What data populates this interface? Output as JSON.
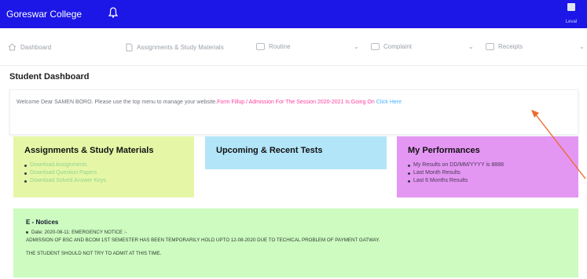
{
  "header": {
    "brand": "Goreswar College",
    "user_label": "Leval"
  },
  "menu": {
    "items": [
      {
        "label": "Dashboard",
        "icon": "home-icon"
      },
      {
        "label": "Assignments & Study Materials",
        "icon": "document-icon"
      },
      {
        "label": "Routine",
        "icon": "calendar-icon"
      },
      {
        "label": "Complaint",
        "icon": "comment-icon"
      },
      {
        "label": "Receipts",
        "icon": "receipt-icon"
      }
    ]
  },
  "page": {
    "title": "Student Dashboard"
  },
  "welcome": {
    "text": "Welcome Dear SAMEN BORO. Please use the top menu to manage your website.",
    "announcement": "Form Fillup / Admission For The Session 2020-2021 Is Going On",
    "link_text": "Click Here"
  },
  "cards": {
    "assignments": {
      "title": "Assignments & Study Materials",
      "items": [
        "Download Assignments",
        "Download Question Papers",
        "Download Solved Answer Keys"
      ]
    },
    "tests": {
      "title": "Upcoming & Recent Tests"
    },
    "performance": {
      "title": "My Performances",
      "items": [
        "My Results on DD/MM/YYYY is 8888",
        "Last Month Results",
        "Last 6 Months Results"
      ]
    }
  },
  "notices": {
    "title": "E - Notices",
    "line1": "Date: 2020-08-11: EMERGENCY NOTICE :-",
    "line2": "ADMISSION OF BSC AND BCOM 1ST SEMESTER HAS BEEN TEMPORARILY HOLD UPTO 12-08-2020 DUE TO TECHICAL PROBLEM OF PAYMENT GATWAY.",
    "line3": "THE STUDENT SHOULD NOT TRY TO ADMIT AT THIS TIME."
  },
  "colors": {
    "topbar": "#1c16e6",
    "assignments_card": "#e5f7a6",
    "tests_card": "#b3e5f8",
    "performance_card": "#e496f3",
    "notices_card": "#cdfbc0",
    "announcement": "#ff3ea0",
    "link": "#49b2ff",
    "annotation_arrow": "#ee6a2e"
  }
}
